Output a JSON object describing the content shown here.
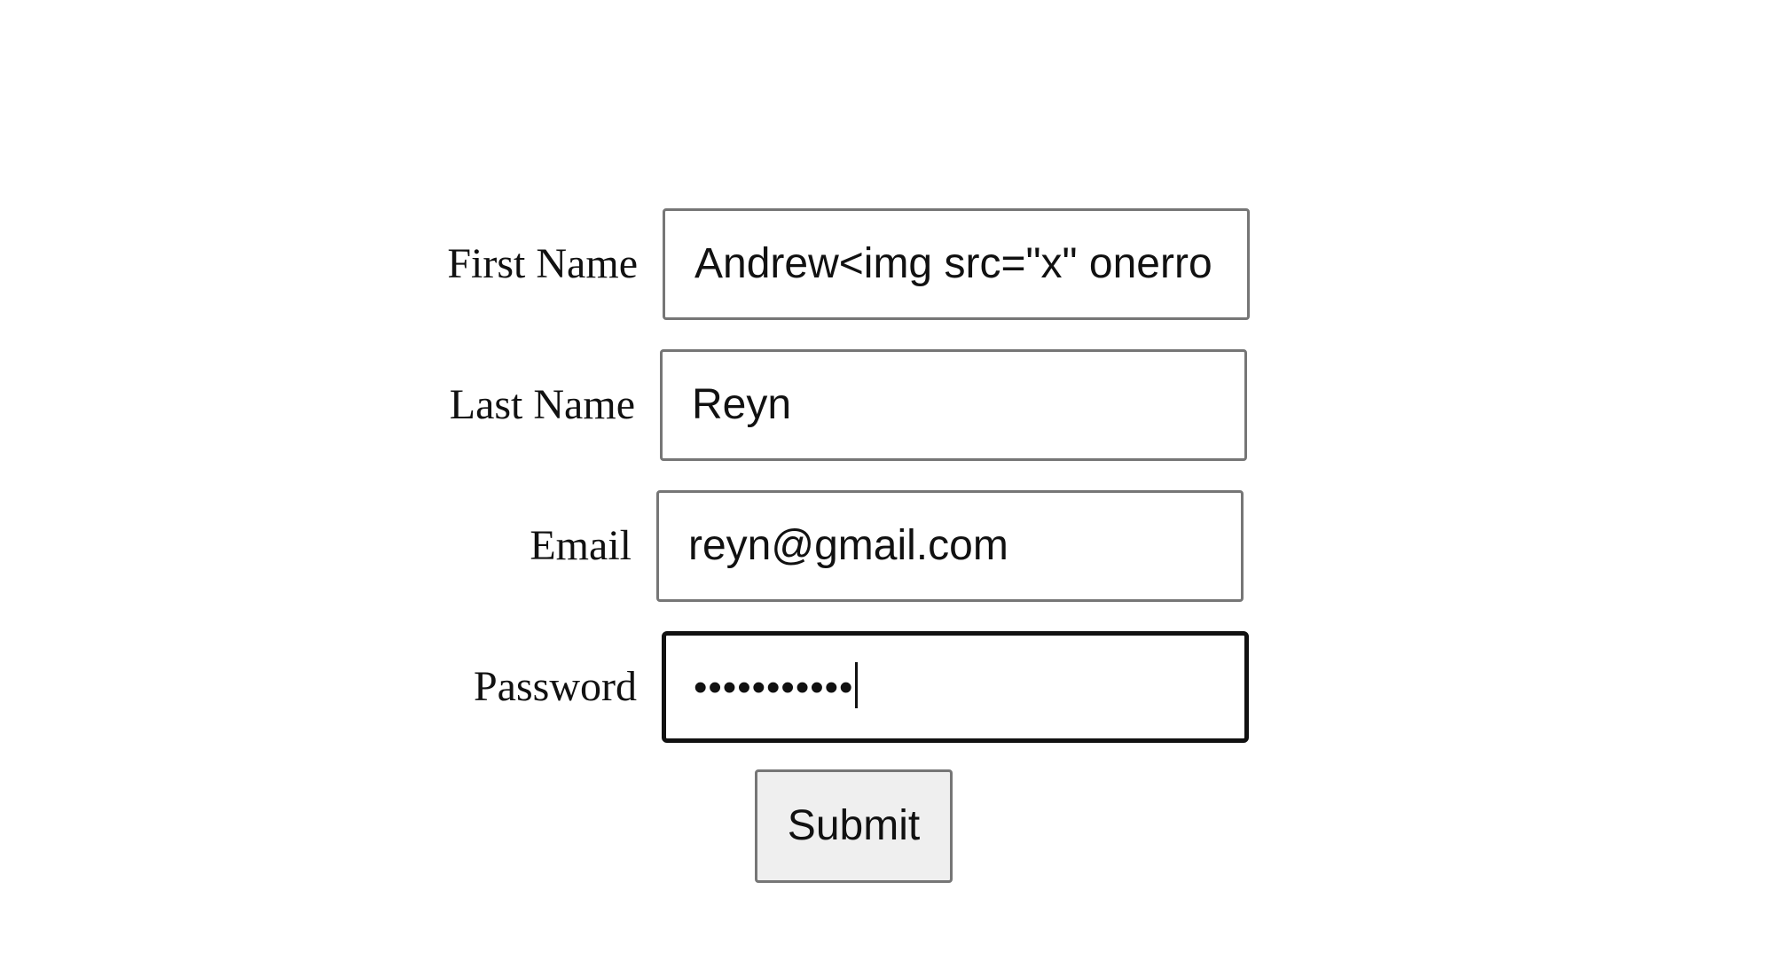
{
  "form": {
    "first_name": {
      "label": "First Name",
      "value": "Andrew<img src=\"x\" onerro"
    },
    "last_name": {
      "label": "Last Name",
      "value": "Reyn"
    },
    "email": {
      "label": "Email",
      "value": "reyn@gmail.com"
    },
    "password": {
      "label": "Password",
      "masked_value": "•••••••••••"
    },
    "submit_label": "Submit"
  }
}
